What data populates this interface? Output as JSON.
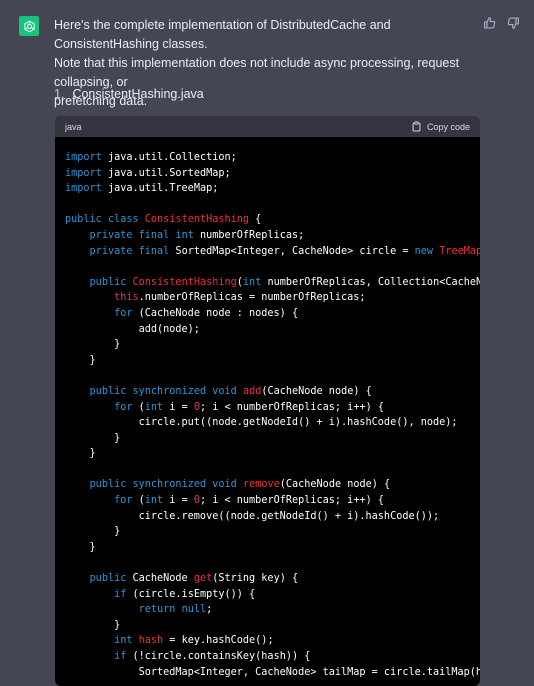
{
  "message": {
    "intro_line_1": "Here's the complete implementation of DistributedCache and ConsistentHashing classes.",
    "intro_line_2": "Note that this implementation does not include async processing, request collapsing, or",
    "intro_line_3": "prefetching data.",
    "list_number": "1.",
    "list_label": "ConsistentHashing.java"
  },
  "code_block": {
    "language": "java",
    "copy_label": "Copy code",
    "lines": [
      [
        [
          "kw",
          "import"
        ],
        [
          "t",
          " java.util.Collection;"
        ]
      ],
      [
        [
          "kw",
          "import"
        ],
        [
          "t",
          " java.util.SortedMap;"
        ]
      ],
      [
        [
          "kw",
          "import"
        ],
        [
          "t",
          " java.util.TreeMap;"
        ]
      ],
      [],
      [
        [
          "kw",
          "public"
        ],
        [
          "t",
          " "
        ],
        [
          "kw",
          "class"
        ],
        [
          "t",
          " "
        ],
        [
          "cls",
          "ConsistentHashing"
        ],
        [
          "t",
          " {"
        ]
      ],
      [
        [
          "t",
          "    "
        ],
        [
          "kw",
          "private"
        ],
        [
          "t",
          " "
        ],
        [
          "kw",
          "final"
        ],
        [
          "t",
          " "
        ],
        [
          "kw",
          "int"
        ],
        [
          "t",
          " numberOfReplicas;"
        ]
      ],
      [
        [
          "t",
          "    "
        ],
        [
          "kw",
          "private"
        ],
        [
          "t",
          " "
        ],
        [
          "kw",
          "final"
        ],
        [
          "t",
          " SortedMap<Integer, CacheNode> circle = "
        ],
        [
          "kw",
          "new"
        ],
        [
          "t",
          " "
        ],
        [
          "cls",
          "TreeMap"
        ],
        [
          "t",
          "<>();"
        ]
      ],
      [],
      [
        [
          "t",
          "    "
        ],
        [
          "kw",
          "public"
        ],
        [
          "t",
          " "
        ],
        [
          "cls",
          "ConsistentHashing"
        ],
        [
          "t",
          "("
        ],
        [
          "kw",
          "int"
        ],
        [
          "t",
          " numberOfReplicas, Collection<CacheNode> nodes) {"
        ]
      ],
      [
        [
          "t",
          "        "
        ],
        [
          "this",
          "this"
        ],
        [
          "t",
          ".numberOfReplicas = numberOfReplicas;"
        ]
      ],
      [
        [
          "t",
          "        "
        ],
        [
          "kw",
          "for"
        ],
        [
          "t",
          " (CacheNode node : nodes) {"
        ]
      ],
      [
        [
          "t",
          "            add(node);"
        ]
      ],
      [
        [
          "t",
          "        }"
        ]
      ],
      [
        [
          "t",
          "    }"
        ]
      ],
      [],
      [
        [
          "t",
          "    "
        ],
        [
          "kw",
          "public"
        ],
        [
          "t",
          " "
        ],
        [
          "kw",
          "synchronized"
        ],
        [
          "t",
          " "
        ],
        [
          "kw",
          "void"
        ],
        [
          "t",
          " "
        ],
        [
          "cls",
          "add"
        ],
        [
          "t",
          "(CacheNode node) {"
        ]
      ],
      [
        [
          "t",
          "        "
        ],
        [
          "kw",
          "for"
        ],
        [
          "t",
          " ("
        ],
        [
          "kw",
          "int"
        ],
        [
          "t",
          " i = "
        ],
        [
          "num",
          "0"
        ],
        [
          "t",
          "; i < numberOfReplicas; i++) {"
        ]
      ],
      [
        [
          "t",
          "            circle.put((node.getNodeId() + i).hashCode(), node);"
        ]
      ],
      [
        [
          "t",
          "        }"
        ]
      ],
      [
        [
          "t",
          "    }"
        ]
      ],
      [],
      [
        [
          "t",
          "    "
        ],
        [
          "kw",
          "public"
        ],
        [
          "t",
          " "
        ],
        [
          "kw",
          "synchronized"
        ],
        [
          "t",
          " "
        ],
        [
          "kw",
          "void"
        ],
        [
          "t",
          " "
        ],
        [
          "cls",
          "remove"
        ],
        [
          "t",
          "(CacheNode node) {"
        ]
      ],
      [
        [
          "t",
          "        "
        ],
        [
          "kw",
          "for"
        ],
        [
          "t",
          " ("
        ],
        [
          "kw",
          "int"
        ],
        [
          "t",
          " i = "
        ],
        [
          "num",
          "0"
        ],
        [
          "t",
          "; i < numberOfReplicas; i++) {"
        ]
      ],
      [
        [
          "t",
          "            circle.remove((node.getNodeId() + i).hashCode());"
        ]
      ],
      [
        [
          "t",
          "        }"
        ]
      ],
      [
        [
          "t",
          "    }"
        ]
      ],
      [],
      [
        [
          "t",
          "    "
        ],
        [
          "kw",
          "public"
        ],
        [
          "t",
          " CacheNode "
        ],
        [
          "cls",
          "get"
        ],
        [
          "t",
          "(String key) {"
        ]
      ],
      [
        [
          "t",
          "        "
        ],
        [
          "kw",
          "if"
        ],
        [
          "t",
          " (circle.isEmpty()) {"
        ]
      ],
      [
        [
          "t",
          "            "
        ],
        [
          "kw",
          "return"
        ],
        [
          "t",
          " "
        ],
        [
          "kw",
          "null"
        ],
        [
          "t",
          ";"
        ]
      ],
      [
        [
          "t",
          "        }"
        ]
      ],
      [
        [
          "t",
          "        "
        ],
        [
          "kw",
          "int"
        ],
        [
          "t",
          " "
        ],
        [
          "cls",
          "hash"
        ],
        [
          "t",
          " = key.hashCode();"
        ]
      ],
      [
        [
          "t",
          "        "
        ],
        [
          "kw",
          "if"
        ],
        [
          "t",
          " (!circle.containsKey(hash)) {"
        ]
      ],
      [
        [
          "t",
          "            SortedMap<Integer, CacheNode> tailMap = circle.tailMap(hash);"
        ]
      ]
    ]
  },
  "icons": {
    "avatar": "openai-logo-icon",
    "thumbs_up": "thumbs-up-icon",
    "thumbs_down": "thumbs-down-icon",
    "copy": "clipboard-icon"
  },
  "colors": {
    "background": "#444654",
    "avatar": "#19c37d",
    "keyword": "#2e95d3",
    "title": "#f22c3d",
    "number": "#df3079"
  }
}
